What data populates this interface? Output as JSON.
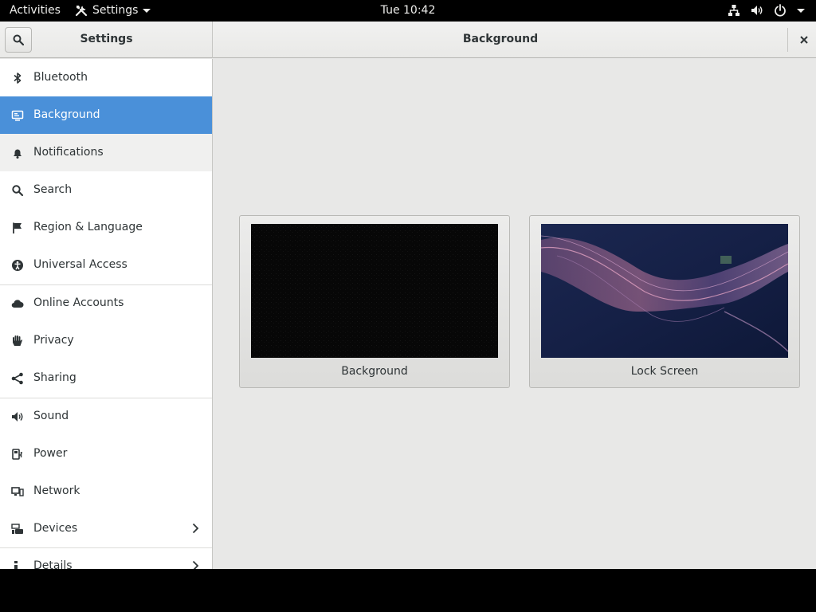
{
  "topbar": {
    "activities": "Activities",
    "app_name": "Settings",
    "clock": "Tue 10:42"
  },
  "headerbar": {
    "left_title": "Settings",
    "right_title": "Background"
  },
  "sidebar": {
    "items": [
      {
        "label": "Bluetooth",
        "icon": "bluetooth-icon"
      },
      {
        "label": "Background",
        "icon": "background-icon",
        "selected": true
      },
      {
        "label": "Notifications",
        "icon": "bell-icon"
      },
      {
        "label": "Search",
        "icon": "search-icon"
      },
      {
        "label": "Region & Language",
        "icon": "flag-icon"
      },
      {
        "label": "Universal Access",
        "icon": "accessibility-icon"
      },
      {
        "label": "Online Accounts",
        "icon": "cloud-icon"
      },
      {
        "label": "Privacy",
        "icon": "hand-icon"
      },
      {
        "label": "Sharing",
        "icon": "share-icon"
      },
      {
        "label": "Sound",
        "icon": "speaker-icon"
      },
      {
        "label": "Power",
        "icon": "power-plug-icon"
      },
      {
        "label": "Network",
        "icon": "network-icon"
      },
      {
        "label": "Devices",
        "icon": "devices-icon",
        "has_submenu": true
      },
      {
        "label": "Details",
        "icon": "info-icon",
        "has_submenu": true
      }
    ]
  },
  "content": {
    "background_label": "Background",
    "lock_screen_label": "Lock Screen"
  },
  "colors": {
    "accent": "#4a90d9",
    "topbar": "#000000",
    "window_bg": "#e8e8e7"
  }
}
